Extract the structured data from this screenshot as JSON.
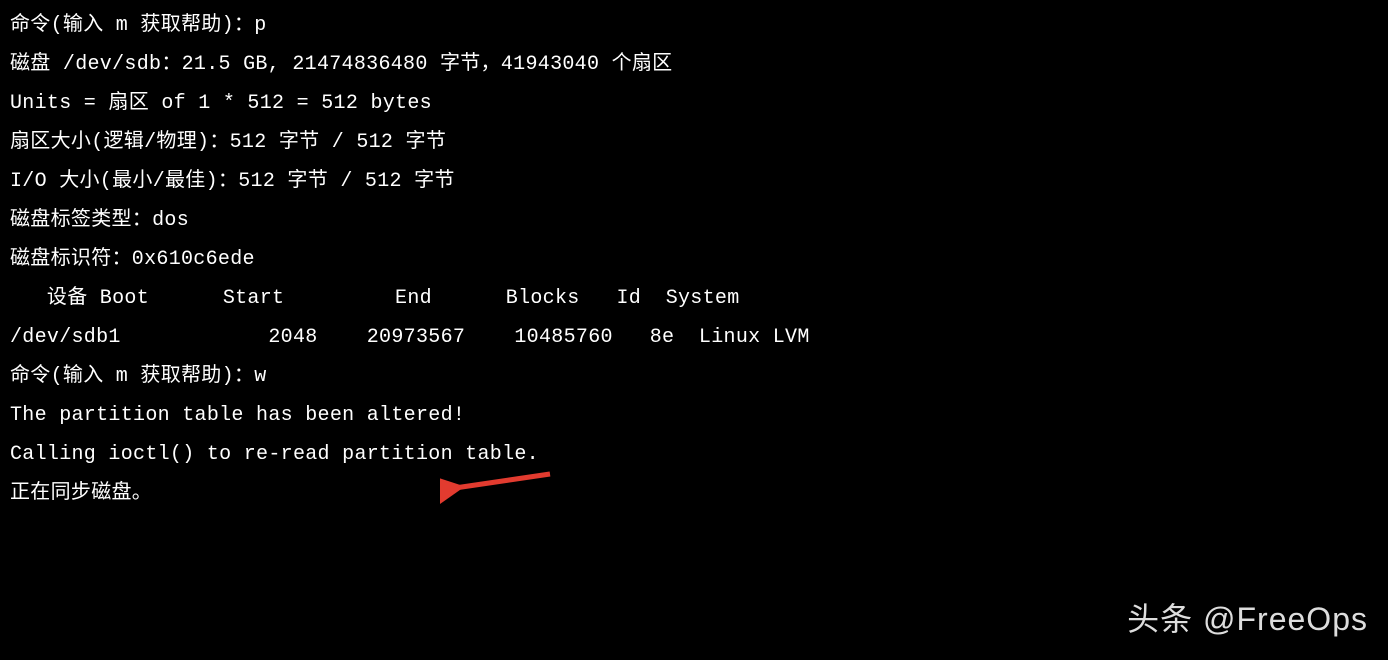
{
  "lines": {
    "l1": "命令(输入 m 获取帮助)：p",
    "l2": "",
    "l3": "磁盘 /dev/sdb：21.5 GB, 21474836480 字节，41943040 个扇区",
    "l4": "Units = 扇区 of 1 * 512 = 512 bytes",
    "l5": "扇区大小(逻辑/物理)：512 字节 / 512 字节",
    "l6": "I/O 大小(最小/最佳)：512 字节 / 512 字节",
    "l7": "磁盘标签类型：dos",
    "l8": "磁盘标识符：0x610c6ede",
    "l9": "",
    "lh": "   设备 Boot      Start         End      Blocks   Id  System",
    "lr": "/dev/sdb1            2048    20973567    10485760   8e  Linux LVM",
    "l10": "",
    "l11": "命令(输入 m 获取帮助)：w",
    "l12": "The partition table has been altered!",
    "l13": "",
    "l14": "Calling ioctl() to re-read partition table.",
    "l15": "正在同步磁盘。"
  },
  "watermark": "头条 @FreeOps",
  "arrow_color": "#e23b2f"
}
